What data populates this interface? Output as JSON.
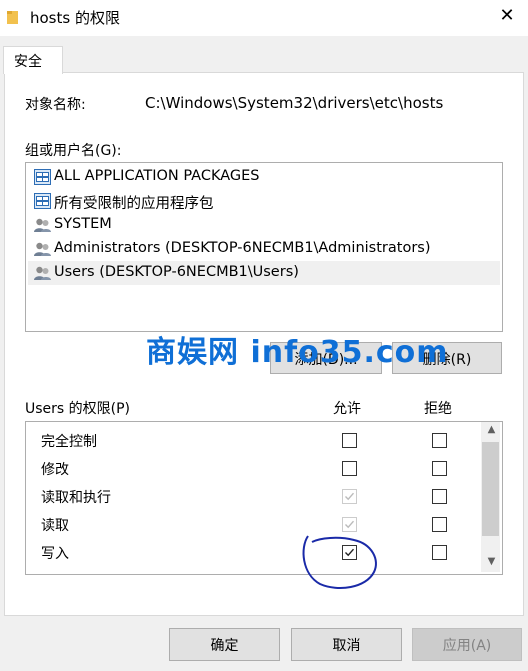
{
  "window": {
    "title": "hosts 的权限",
    "close_glyph": "✕"
  },
  "tabs": [
    {
      "label": "安全"
    }
  ],
  "object": {
    "label": "对象名称:",
    "value": "C:\\Windows\\System32\\drivers\\etc\\hosts"
  },
  "groups": {
    "label": "组或用户名(G):",
    "items": [
      {
        "name": "ALL APPLICATION PACKAGES",
        "icon": "package-icon"
      },
      {
        "name": "所有受限制的应用程序包",
        "icon": "package-icon"
      },
      {
        "name": "SYSTEM",
        "icon": "users-icon"
      },
      {
        "name": "Administrators (DESKTOP-6NECMB1\\Administrators)",
        "icon": "users-icon"
      },
      {
        "name": "Users (DESKTOP-6NECMB1\\Users)",
        "icon": "users-icon",
        "selected": true
      }
    ],
    "add_button": "添加(D)...",
    "remove_button": "删除(R)"
  },
  "permissions": {
    "label": "Users 的权限(P)",
    "allow_header": "允许",
    "deny_header": "拒绝",
    "rows": [
      {
        "name": "完全控制",
        "allow": false,
        "allow_disabled": false,
        "deny": false
      },
      {
        "name": "修改",
        "allow": false,
        "allow_disabled": false,
        "deny": false
      },
      {
        "name": "读取和执行",
        "allow": true,
        "allow_disabled": true,
        "deny": false
      },
      {
        "name": "读取",
        "allow": true,
        "allow_disabled": true,
        "deny": false
      },
      {
        "name": "写入",
        "allow": true,
        "allow_disabled": false,
        "deny": false
      }
    ]
  },
  "footer": {
    "ok": "确定",
    "cancel": "取消",
    "apply": "应用(A)"
  },
  "watermark": "商娱网 info35.com",
  "colors": {
    "watermark": "#0f6fd6",
    "annotation": "#1a2aa8"
  }
}
